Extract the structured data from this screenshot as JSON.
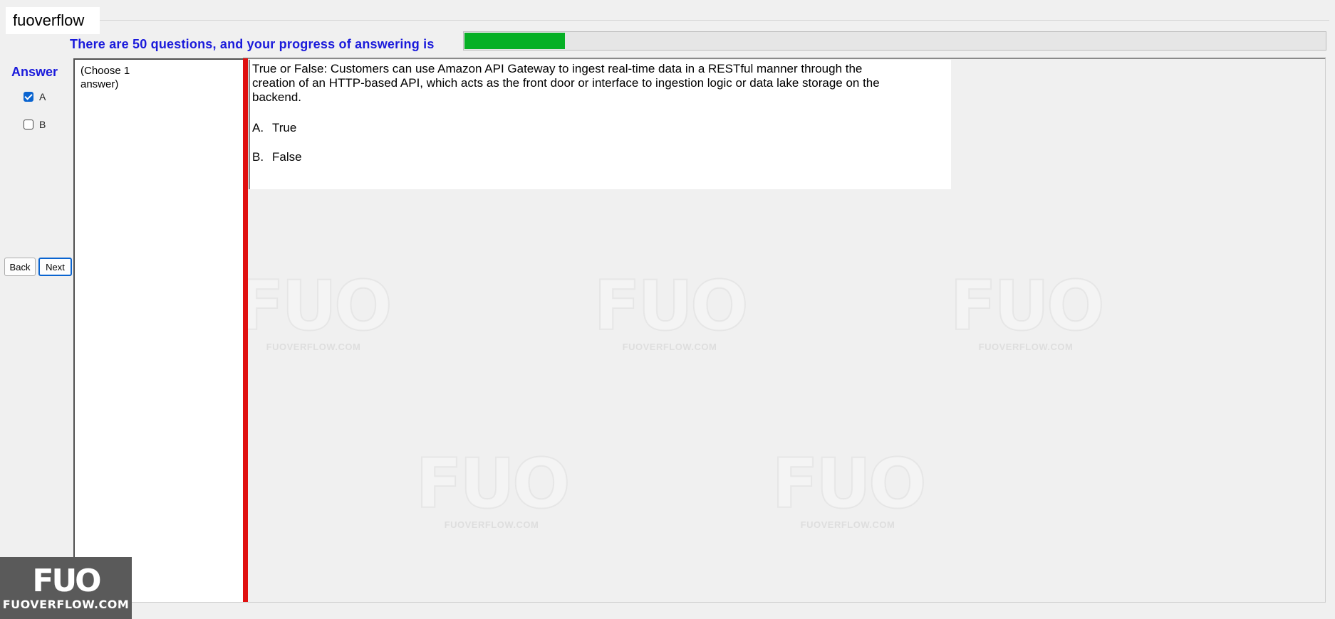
{
  "window": {
    "title": "fuoverflow"
  },
  "progress": {
    "label": "There are 50 questions, and your progress of answering is",
    "fraction": 0.117,
    "color": "#06b025"
  },
  "answer_panel": {
    "title": "Answer",
    "options": [
      {
        "label": "A",
        "checked": true
      },
      {
        "label": "B",
        "checked": false
      }
    ],
    "back_label": "Back",
    "next_label": "Next"
  },
  "instruction": {
    "text": "(Choose 1 answer)"
  },
  "question": {
    "text": "True or False: Customers can use Amazon API Gateway to ingest real-time data in a RESTful manner through the creation of an HTTP-based API, which acts as the front door or interface to ingestion logic or data lake storage on the backend.",
    "choices": [
      {
        "letter": "A.",
        "text": "True"
      },
      {
        "letter": "B.",
        "text": "False"
      }
    ]
  },
  "watermark": {
    "mark": "FUO",
    "site": "FUOVERFLOW.COM"
  },
  "corner_logo": {
    "mark": "FUO",
    "site": "FUOVERFLOW.COM"
  },
  "colors": {
    "accent_blue": "#1a1adb",
    "red_bar": "#e01010",
    "progress_green": "#06b025"
  }
}
